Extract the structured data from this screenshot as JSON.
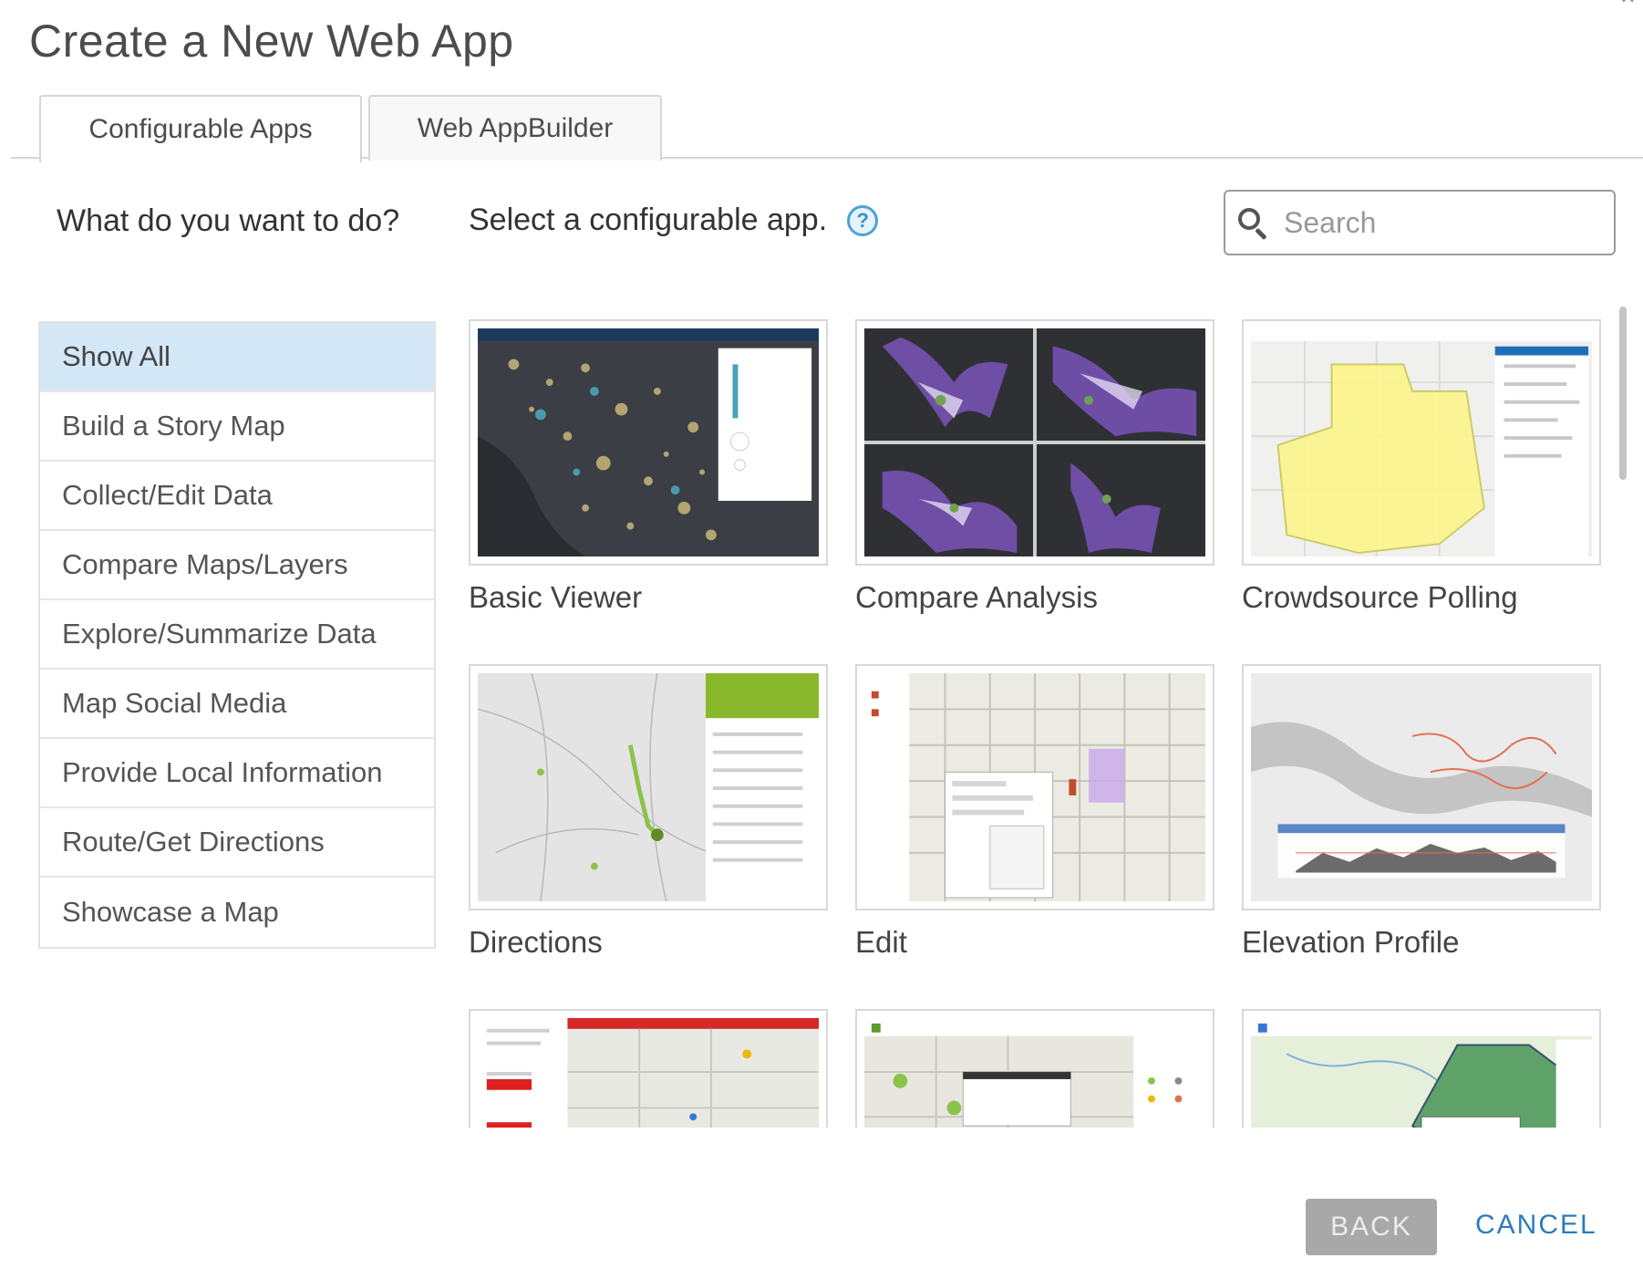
{
  "dialog": {
    "title": "Create a New Web App"
  },
  "tabs": [
    {
      "label": "Configurable Apps",
      "active": true
    },
    {
      "label": "Web AppBuilder",
      "active": false
    }
  ],
  "sidebar": {
    "heading": "What do you want to do?",
    "items": [
      {
        "label": "Show All",
        "selected": true
      },
      {
        "label": "Build a Story Map"
      },
      {
        "label": "Collect/Edit Data"
      },
      {
        "label": "Compare Maps/Layers"
      },
      {
        "label": "Explore/Summarize Data"
      },
      {
        "label": "Map Social Media"
      },
      {
        "label": "Provide Local Information"
      },
      {
        "label": "Route/Get Directions"
      },
      {
        "label": "Showcase a Map"
      }
    ]
  },
  "main": {
    "instruction": "Select a configurable app.",
    "help_icon": "question-circle-icon",
    "search": {
      "placeholder": "Search",
      "value": ""
    },
    "apps": [
      {
        "label": "Basic Viewer"
      },
      {
        "label": "Compare Analysis"
      },
      {
        "label": "Crowdsource Polling"
      },
      {
        "label": "Directions"
      },
      {
        "label": "Edit"
      },
      {
        "label": "Elevation Profile"
      },
      {
        "label": ""
      },
      {
        "label": ""
      },
      {
        "label": ""
      }
    ]
  },
  "footer": {
    "back_label": "BACK",
    "cancel_label": "CANCEL"
  },
  "colors": {
    "accent": "#2b7bbf",
    "selected_bg": "#d3e7f6",
    "disabled_button": "#a8a8a8"
  }
}
